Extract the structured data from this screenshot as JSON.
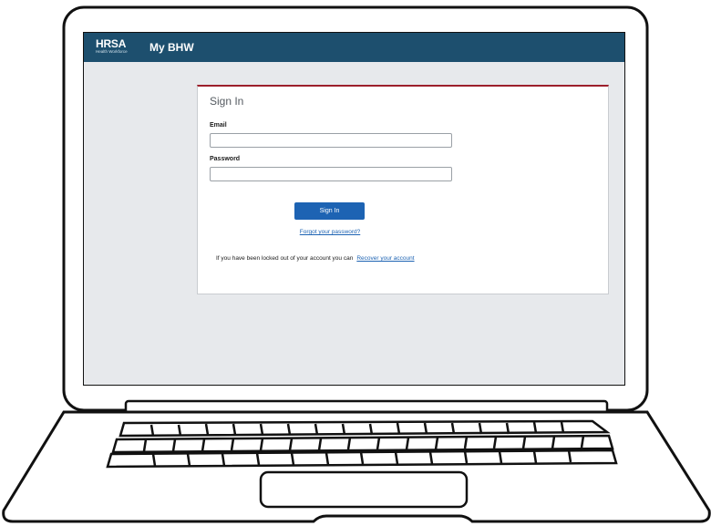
{
  "header": {
    "logo_text": "HRSA",
    "logo_subtext": "Health Workforce",
    "app_title": "My BHW"
  },
  "signin": {
    "title": "Sign In",
    "email_label": "Email",
    "email_value": "",
    "password_label": "Password",
    "password_value": "",
    "button_label": "Sign In",
    "forgot_link": "Forgot your password?",
    "locked_text": "If you have been locked out of your account you can",
    "recover_link": "Recover your account"
  },
  "colors": {
    "header_bg": "#1d4f6e",
    "card_accent": "#9c1f2b",
    "primary_button": "#1d63b3",
    "screen_bg": "#e7e9ec"
  }
}
